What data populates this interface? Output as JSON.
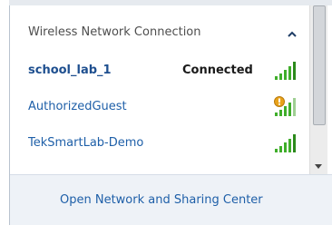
{
  "popup": {
    "section_title": "Wireless Network Connection",
    "collapse_icon": "chevron-up-icon",
    "networks": [
      {
        "name": "school_lab_1",
        "status": "Connected",
        "signal_bars": 5,
        "signal_icon": "wifi-signal-icon",
        "secured_warning": false
      },
      {
        "name": "AuthorizedGuest",
        "status": "",
        "signal_bars": 4,
        "signal_icon": "wifi-signal-warning-icon",
        "secured_warning": true
      },
      {
        "name": "TekSmartLab-Demo",
        "status": "",
        "signal_bars": 5,
        "signal_icon": "wifi-signal-icon",
        "secured_warning": false
      }
    ],
    "footer_link": "Open Network and Sharing Center"
  },
  "colors": {
    "link_blue": "#1e5fa8",
    "signal_green": "#3fae2a",
    "signal_green_dark": "#2c8a1c",
    "warning_orange": "#e8a21a",
    "footer_bg": "#eef2f7"
  }
}
